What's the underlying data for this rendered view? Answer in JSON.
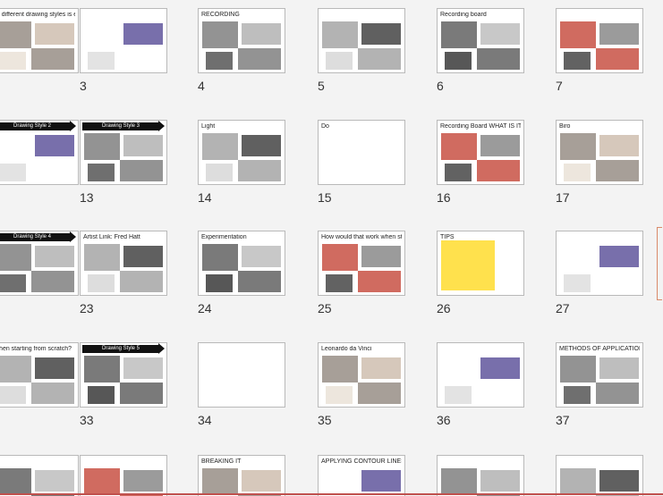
{
  "slides": [
    {
      "number": "",
      "text": "of different drawing styles is essential element of my project"
    },
    {
      "number": "3",
      "text": ""
    },
    {
      "number": "4",
      "text": "RECORDING"
    },
    {
      "number": "5",
      "text": ""
    },
    {
      "number": "6",
      "text": "Recording board"
    },
    {
      "number": "7",
      "text": ""
    },
    {
      "number": "",
      "text": "Drawing Style 2"
    },
    {
      "number": "13",
      "text": "Drawing Style 3"
    },
    {
      "number": "14",
      "text": "Light"
    },
    {
      "number": "15",
      "text": "Do"
    },
    {
      "number": "16",
      "text": "Recording Board WHAT IS IT?"
    },
    {
      "number": "17",
      "text": "Biro"
    },
    {
      "number": "",
      "text": "Drawing Style 4"
    },
    {
      "number": "23",
      "text": "Artist Link: Fred Hatt"
    },
    {
      "number": "24",
      "text": "Experimentation"
    },
    {
      "number": "25",
      "text": "How would that work when started from scratch?"
    },
    {
      "number": "26",
      "text": "TIPS"
    },
    {
      "number": "27",
      "text": ""
    },
    {
      "number": "",
      "text": "when starting from scratch?"
    },
    {
      "number": "33",
      "text": "Drawing Style 5"
    },
    {
      "number": "34",
      "text": ""
    },
    {
      "number": "35",
      "text": "Leonardo da Vinci"
    },
    {
      "number": "36",
      "text": ""
    },
    {
      "number": "37",
      "text": "METHODS OF APPLICATION"
    },
    {
      "number": "",
      "text": ""
    },
    {
      "number": "",
      "text": ""
    },
    {
      "number": "",
      "text": "BREAKING IT"
    },
    {
      "number": "",
      "text": "APPLYING CONTOUR LINES"
    },
    {
      "number": "",
      "text": ""
    },
    {
      "number": "",
      "text": ""
    }
  ],
  "colors": {
    "background": "#f3f3f3",
    "accent": "#c0504d",
    "sticky_note": "#ffe14d"
  }
}
